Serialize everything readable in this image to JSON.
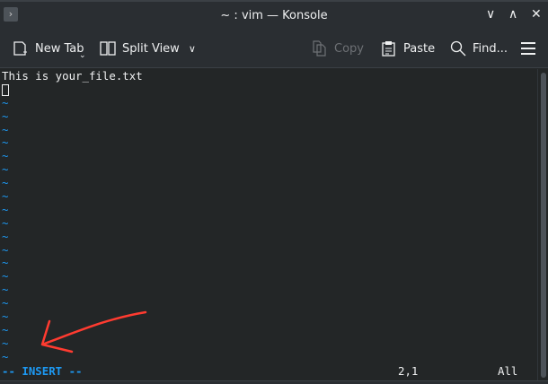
{
  "window": {
    "title": "~ : vim — Konsole"
  },
  "toolbar": {
    "new_tab": "New Tab",
    "split_view": "Split View",
    "copy": "Copy",
    "paste": "Paste",
    "find": "Find..."
  },
  "terminal": {
    "lines": [
      "This is your_file.txt"
    ],
    "tilde": "~",
    "tilde_count": 20
  },
  "status": {
    "mode": "-- INSERT --",
    "position": "2,1",
    "scroll": "All"
  },
  "colors": {
    "background": "#232627",
    "tilde": "#1d99f3",
    "annotation": "#ff3b30"
  }
}
